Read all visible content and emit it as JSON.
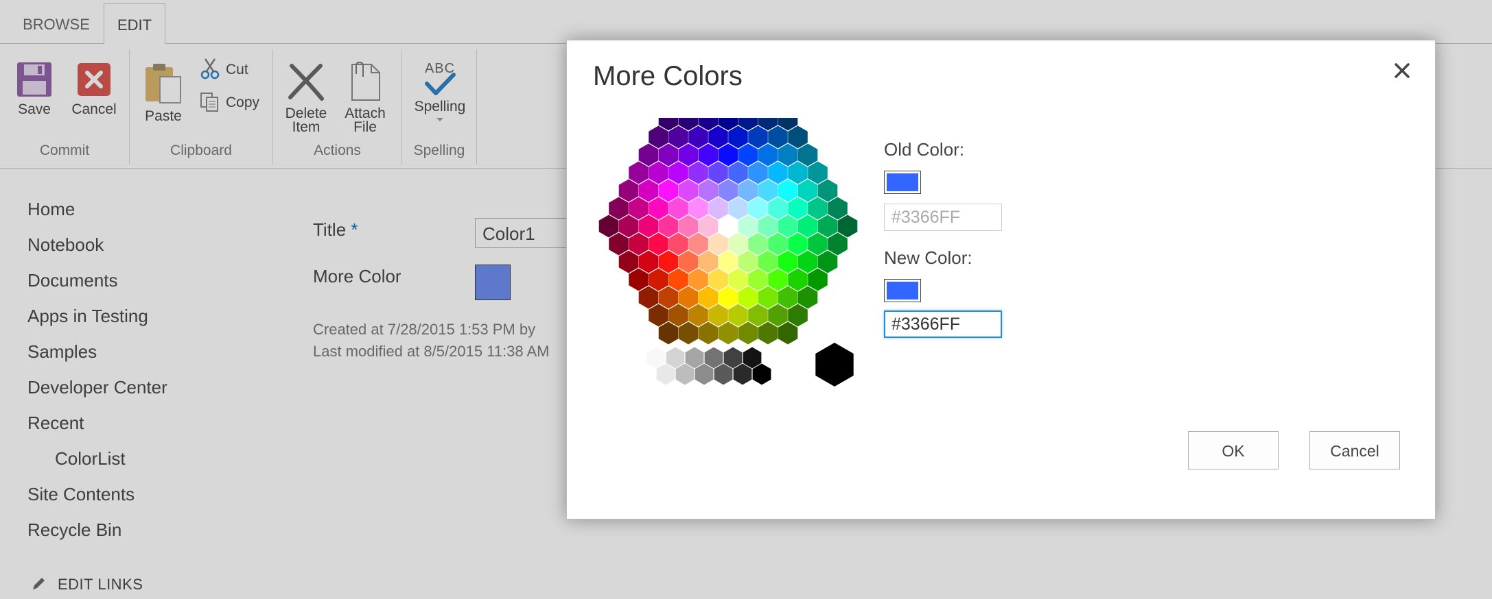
{
  "ribbon": {
    "tabs": [
      "BROWSE",
      "EDIT"
    ],
    "groups": {
      "commit": {
        "label": "Commit",
        "save": "Save",
        "cancel": "Cancel"
      },
      "clipboard": {
        "label": "Clipboard",
        "paste": "Paste",
        "cut": "Cut",
        "copy": "Copy"
      },
      "actions": {
        "label": "Actions",
        "delete_line1": "Delete",
        "delete_line2": "Item",
        "attach_line1": "Attach",
        "attach_line2": "File"
      },
      "spelling": {
        "label": "Spelling",
        "spelling": "Spelling",
        "abc": "ABC"
      }
    }
  },
  "nav": {
    "items": [
      "Home",
      "Notebook",
      "Documents",
      "Apps in Testing",
      "Samples",
      "Developer Center",
      "Recent",
      "ColorList",
      "Site Contents",
      "Recycle Bin"
    ],
    "edit_links": "EDIT LINKS"
  },
  "form": {
    "title_label": "Title",
    "required_mark": "*",
    "title_value": "Color1",
    "more_color_label": "More Color",
    "created": "Created at 7/28/2015 1:53 PM  by",
    "modified": "Last modified at 8/5/2015 11:38 AM"
  },
  "dialog": {
    "title": "More Colors",
    "old_color_label": "Old Color:",
    "old_color_value": "#3366FF",
    "new_color_label": "New Color:",
    "new_color_value": "#3366FF",
    "ok": "OK",
    "cancel": "Cancel",
    "swatch_color": "#3366FF"
  },
  "icons": {
    "close": "close-icon",
    "save": "floppy-disk-icon",
    "cancel": "cancel-x-icon",
    "paste": "clipboard-icon",
    "cut": "scissors-icon",
    "copy": "copy-icon",
    "delete": "delete-x-icon",
    "attach": "paperclip-icon",
    "spelling": "checkmark-icon",
    "edit_links": "pencil-icon"
  }
}
